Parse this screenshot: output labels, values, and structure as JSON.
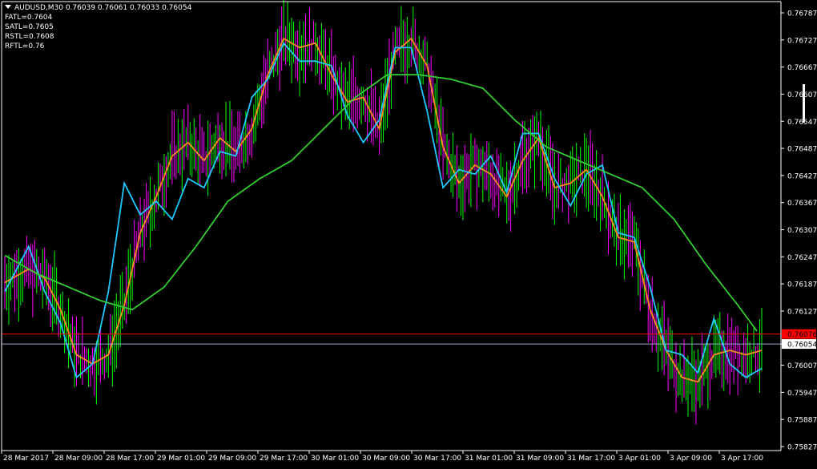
{
  "header": {
    "symbol_line": "AUDUSD,M30  0.76039 0.76061 0.76033 0.76054",
    "indicators": [
      "FATL=0.7604",
      "SATL=0.7605",
      "RSTL=0.7608",
      "RFTL=0.76"
    ]
  },
  "colors": {
    "background": "#000000",
    "bull_bar": "#00ff00",
    "bear_bar": "#ff00ff",
    "fatl": "#ff8c1a",
    "satl": "#1ec8ff",
    "rstl": "#32cd32",
    "red_level": "#ff0000",
    "current_price_line": "#8fa6c8"
  },
  "chart_data": {
    "type": "line",
    "title": "",
    "ylim": [
      0.75827,
      0.76787
    ],
    "y_ticks": [
      "0.76787",
      "0.76727",
      "0.76667",
      "0.76607",
      "0.76547",
      "0.76487",
      "0.76427",
      "0.76367",
      "0.76307",
      "0.76247",
      "0.76187",
      "0.76127",
      "0.76054",
      "0.76007",
      "0.75947",
      "0.75887",
      "0.75827"
    ],
    "x_ticks": [
      "28 Mar 2017",
      "28 Mar 09:00",
      "28 Mar 17:00",
      "29 Mar 01:00",
      "29 Mar 09:00",
      "29 Mar 17:00",
      "30 Mar 01:00",
      "30 Mar 09:00",
      "30 Mar 17:00",
      "31 Mar 01:00",
      "31 Mar 09:00",
      "31 Mar 17:00",
      "3 Apr 01:00",
      "3 Apr 09:00",
      "3 Apr 17:00"
    ],
    "price_labels": {
      "red_level": "0.76076",
      "current": "0.76054"
    },
    "levels": {
      "red_level": 0.76076,
      "current": 0.76054
    },
    "series": [
      {
        "name": "FATL",
        "x": [
          0,
          30,
          50,
          70,
          90,
          110,
          130,
          150,
          170,
          190,
          210,
          230,
          250,
          270,
          290,
          310,
          330,
          350,
          370,
          390,
          410,
          430,
          450,
          470,
          490,
          510,
          530,
          550,
          570,
          590,
          610,
          630,
          650,
          670,
          690,
          710,
          730,
          750,
          770,
          790,
          810,
          830,
          850,
          870,
          890,
          910,
          930,
          950
        ],
        "values": [
          0.7619,
          0.7622,
          0.762,
          0.7613,
          0.7603,
          0.7601,
          0.7603,
          0.7614,
          0.763,
          0.7638,
          0.7647,
          0.765,
          0.7646,
          0.7651,
          0.7648,
          0.7653,
          0.7665,
          0.7673,
          0.7671,
          0.7672,
          0.7665,
          0.7659,
          0.766,
          0.7653,
          0.767,
          0.7673,
          0.7667,
          0.7649,
          0.7641,
          0.7645,
          0.7643,
          0.7638,
          0.7646,
          0.7651,
          0.764,
          0.7641,
          0.7644,
          0.7638,
          0.7629,
          0.7628,
          0.7613,
          0.7604,
          0.7598,
          0.7597,
          0.7603,
          0.7604,
          0.7603,
          0.7604
        ]
      },
      {
        "name": "SATL",
        "x": [
          0,
          30,
          50,
          70,
          90,
          110,
          130,
          150,
          170,
          190,
          210,
          230,
          250,
          270,
          290,
          310,
          330,
          350,
          370,
          390,
          410,
          430,
          450,
          470,
          490,
          510,
          530,
          550,
          570,
          590,
          610,
          630,
          650,
          670,
          690,
          710,
          730,
          750,
          770,
          790,
          810,
          830,
          850,
          870,
          890,
          910,
          930,
          950
        ],
        "values": [
          0.7617,
          0.7627,
          0.7617,
          0.761,
          0.7598,
          0.7601,
          0.7617,
          0.7641,
          0.7634,
          0.7637,
          0.7633,
          0.7642,
          0.764,
          0.7648,
          0.7647,
          0.766,
          0.7664,
          0.7672,
          0.7668,
          0.7668,
          0.7667,
          0.7656,
          0.765,
          0.7655,
          0.7671,
          0.7671,
          0.7657,
          0.764,
          0.7644,
          0.7643,
          0.7647,
          0.7639,
          0.7652,
          0.7652,
          0.7642,
          0.7636,
          0.7643,
          0.7645,
          0.763,
          0.7629,
          0.7618,
          0.7604,
          0.7603,
          0.7599,
          0.7611,
          0.7601,
          0.7598,
          0.76
        ]
      },
      {
        "name": "RSTL",
        "x": [
          0,
          40,
          80,
          120,
          160,
          200,
          240,
          280,
          320,
          360,
          400,
          440,
          480,
          520,
          560,
          600,
          640,
          680,
          720,
          760,
          800,
          840,
          880,
          920,
          945
        ],
        "values": [
          0.7625,
          0.7621,
          0.7618,
          0.7615,
          0.7613,
          0.7618,
          0.7627,
          0.7637,
          0.7642,
          0.7646,
          0.7653,
          0.766,
          0.7665,
          0.7665,
          0.7664,
          0.7662,
          0.7655,
          0.7649,
          0.7646,
          0.7643,
          0.764,
          0.7633,
          0.7623,
          0.7614,
          0.7608
        ]
      }
    ],
    "grid": false,
    "legend": "top-left"
  }
}
